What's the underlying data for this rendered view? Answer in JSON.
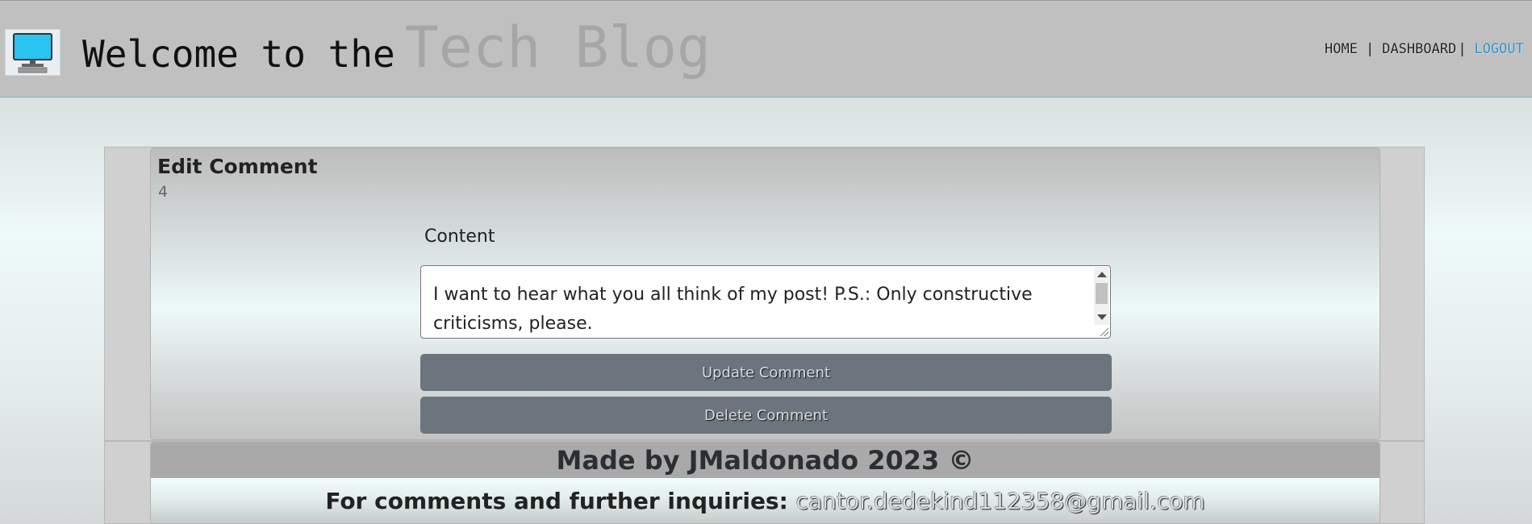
{
  "header": {
    "logo_icon": "computer-monitor-icon",
    "title_welcome": "Welcome to the",
    "title_brand": "Tech Blog",
    "nav": {
      "home": "HOME",
      "separator": "|",
      "dashboard": "DASHBOARD",
      "logout": "LOGOUT"
    }
  },
  "edit_comment": {
    "title": "Edit Comment",
    "comment_id": "4",
    "content_label": "Content",
    "content_value": "I want to hear what you all think of my post! P.S.: Only constructive criticisms, please.",
    "update_button": "Update Comment",
    "delete_button": "Delete Comment"
  },
  "footer": {
    "credit": "Made by JMaldonado 2023 ©",
    "contact_prefix": "For comments and further inquiries:",
    "email": "cantor.dedekind112358@gmail.com"
  },
  "colors": {
    "header_bg": "#c0c0c0",
    "brand_gray": "#a6a6a6",
    "logout_blue": "#2f8fc9",
    "button_bg": "#6c757d",
    "monitor_blue": "#29c4f2"
  }
}
